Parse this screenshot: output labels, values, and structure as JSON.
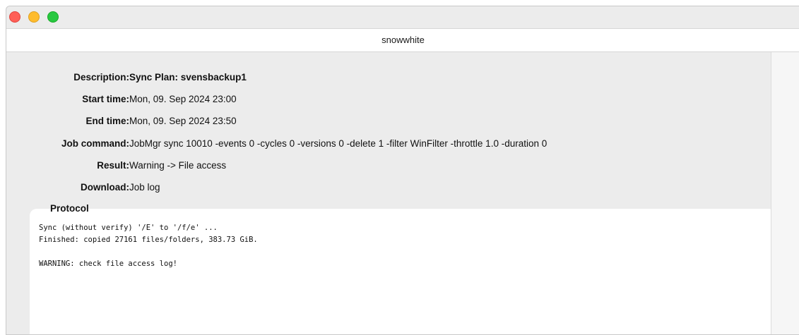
{
  "window": {
    "title": "snowwhite"
  },
  "details": [
    {
      "label": "Description:",
      "value": "Sync Plan: svensbackup1",
      "bold": true
    },
    {
      "label": "Start time:",
      "value": "Mon, 09. Sep 2024 23:00"
    },
    {
      "label": "End time:",
      "value": "Mon, 09. Sep 2024 23:50"
    },
    {
      "label": "Job command:",
      "value": "JobMgr sync 10010 -events 0 -cycles 0 -versions 0 -delete 1 -filter WinFilter -throttle 1.0 -duration 0"
    },
    {
      "label": "Result:",
      "value": "Warning -> File access"
    },
    {
      "label": "Download:",
      "value": "Job log"
    }
  ],
  "protocol": {
    "label": "Protocol",
    "lines": [
      "Sync (without verify) '/E' to '/f/e' ...",
      "Finished: copied 27161 files/folders, 383.73 GiB.",
      "",
      "WARNING: check file access log!"
    ]
  }
}
